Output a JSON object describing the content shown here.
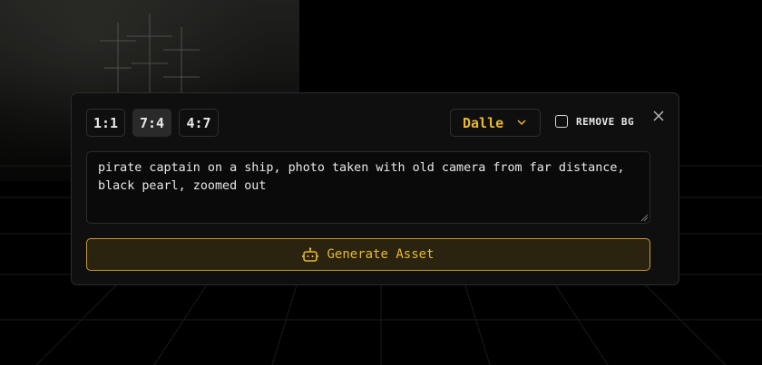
{
  "aspect_ratios": [
    {
      "label": "1:1",
      "active": false
    },
    {
      "label": "7:4",
      "active": true
    },
    {
      "label": "4:7",
      "active": false
    }
  ],
  "model_select": {
    "value": "Dalle",
    "icon": "chevron-down-icon"
  },
  "remove_bg": {
    "label": "REMOVE BG",
    "checked": false
  },
  "close_icon": "close-icon",
  "prompt": {
    "value": "pirate captain on a ship, photo taken with old camera from far distance, black pearl, zoomed out"
  },
  "generate_button": {
    "label": "Generate Asset",
    "icon": "robot-icon"
  },
  "colors": {
    "accent": "#e7b930",
    "panel": "#0f0f0f",
    "button_bg": "#2a2310"
  }
}
